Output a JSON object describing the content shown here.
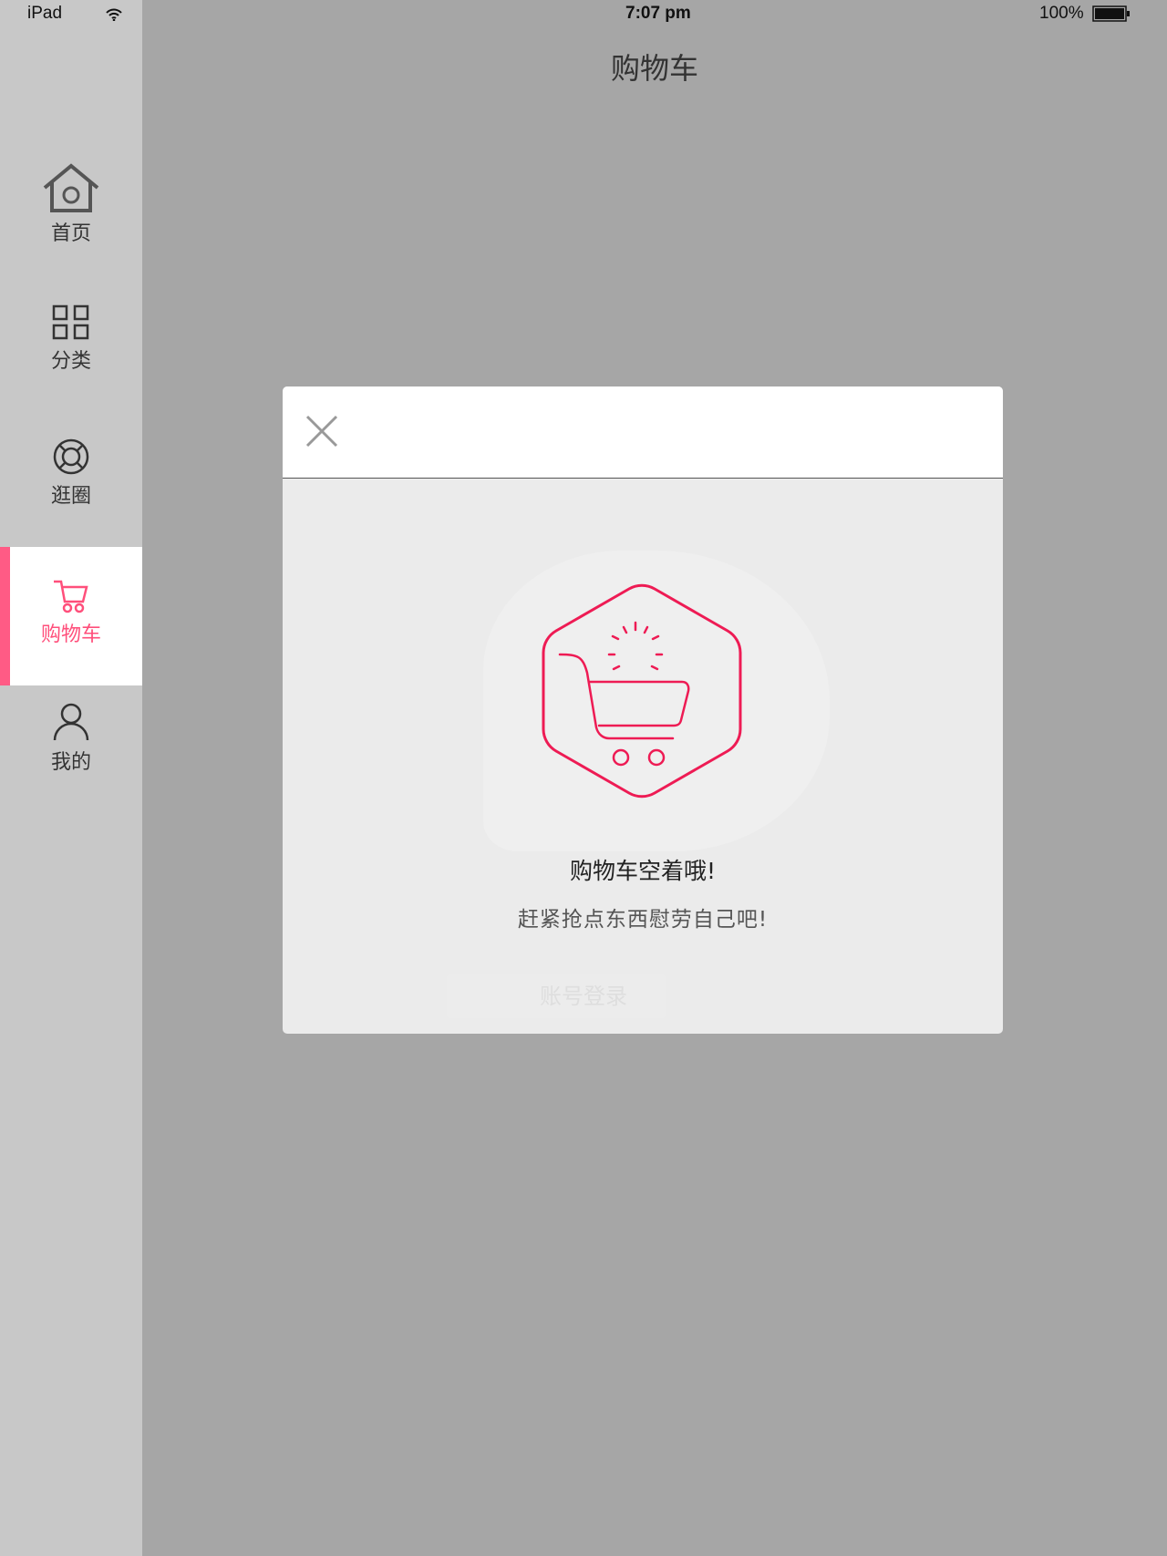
{
  "status_bar": {
    "device": "iPad",
    "time": "7:07 pm",
    "battery": "100%"
  },
  "header": {
    "title": "购物车"
  },
  "sidebar": {
    "items": [
      {
        "label": "首页",
        "icon": "home-icon"
      },
      {
        "label": "分类",
        "icon": "grid-icon"
      },
      {
        "label": "逛圈",
        "icon": "circle-icon"
      },
      {
        "label": "购物车",
        "icon": "cart-icon",
        "selected": true
      },
      {
        "label": "我的",
        "icon": "user-icon"
      }
    ]
  },
  "modal": {
    "title_msg": "购物车空着哦!",
    "sub_msg": "赶紧抢点东西慰劳自己吧!",
    "background_button": "账号登录"
  },
  "colors": {
    "accent": "#ee1b54",
    "selected_bar": "#ff5b85"
  }
}
